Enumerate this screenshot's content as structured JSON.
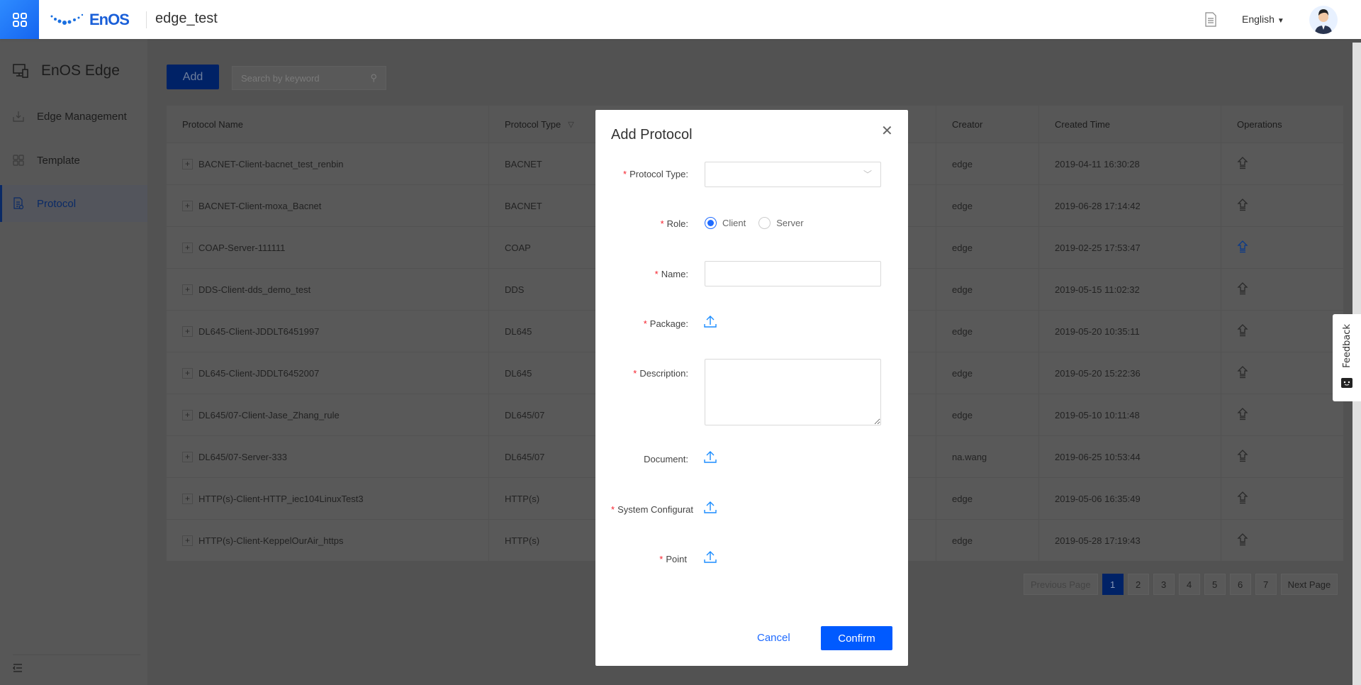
{
  "header": {
    "logo_text": "EnOS",
    "project": "edge_test",
    "language": "English"
  },
  "sidebar": {
    "title": "EnOS Edge",
    "items": [
      {
        "label": "Edge Management"
      },
      {
        "label": "Template"
      },
      {
        "label": "Protocol",
        "active": true
      }
    ]
  },
  "toolbar": {
    "add_label": "Add",
    "search_placeholder": "Search by keyword"
  },
  "table": {
    "columns": [
      "Protocol Name",
      "Protocol Type",
      "Creator",
      "Created Time",
      "Operations"
    ],
    "rows": [
      {
        "name": "BACNET-Client-bacnet_test_renbin",
        "type": "BACNET",
        "creator": "edge",
        "created": "2019-04-11 16:30:28"
      },
      {
        "name": "BACNET-Client-moxa_Bacnet",
        "type": "BACNET",
        "creator": "edge",
        "created": "2019-06-28 17:14:42"
      },
      {
        "name": "COAP-Server-111111",
        "type": "COAP",
        "creator": "edge",
        "created": "2019-02-25 17:53:47"
      },
      {
        "name": "DDS-Client-dds_demo_test",
        "type": "DDS",
        "creator": "edge",
        "created": "2019-05-15 11:02:32"
      },
      {
        "name": "DL645-Client-JDDLT6451997",
        "type": "DL645",
        "creator": "edge",
        "created": "2019-05-20 10:35:11"
      },
      {
        "name": "DL645-Client-JDDLT6452007",
        "type": "DL645",
        "creator": "edge",
        "created": "2019-05-20 15:22:36"
      },
      {
        "name": "DL645/07-Client-Jase_Zhang_rule",
        "type": "DL645/07",
        "creator": "edge",
        "created": "2019-05-10 10:11:48"
      },
      {
        "name": "DL645/07-Server-333",
        "type": "DL645/07",
        "creator": "na.wang",
        "created": "2019-06-25 10:53:44"
      },
      {
        "name": "HTTP(s)-Client-HTTP_iec104LinuxTest3",
        "type": "HTTP(s)",
        "creator": "edge",
        "created": "2019-05-06 16:35:49"
      },
      {
        "name": "HTTP(s)-Client-KeppelOurAir_https",
        "type": "HTTP(s)",
        "creator": "edge",
        "created": "2019-05-28 17:19:43"
      }
    ]
  },
  "pagination": {
    "prev": "Previous Page",
    "next": "Next Page",
    "pages": [
      "1",
      "2",
      "3",
      "4",
      "5",
      "6",
      "7"
    ],
    "current": "1"
  },
  "feedback": {
    "label": "Feedback"
  },
  "modal": {
    "title": "Add Protocol",
    "fields": {
      "protocol_type": "Protocol Type",
      "role": "Role",
      "role_options": [
        "Client",
        "Server"
      ],
      "role_selected": "Client",
      "name": "Name",
      "package": "Package",
      "description": "Description",
      "document": "Document",
      "system_config": "System Configurat",
      "point": "Point"
    },
    "colon": ":",
    "required_mark": "*",
    "cancel": "Cancel",
    "confirm": "Confirm"
  },
  "colors": {
    "accent": "#0a5cff",
    "required": "#f5222d",
    "upload": "#1a8cff"
  }
}
